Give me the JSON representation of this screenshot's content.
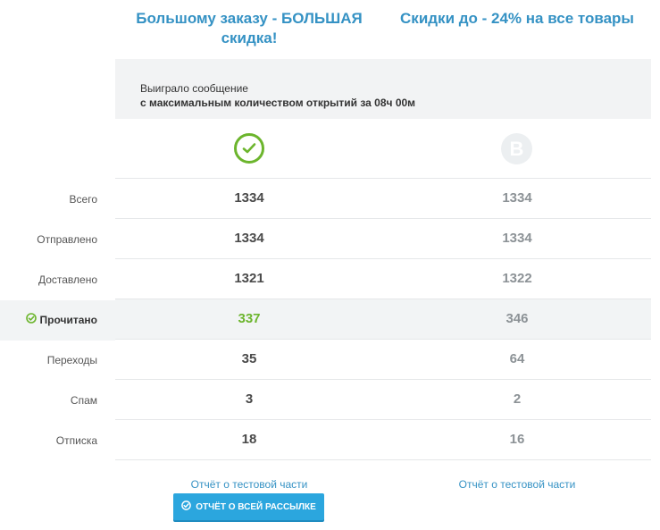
{
  "variants": {
    "a": {
      "title": "Большому заказу - БОЛЬШАЯ скидка!",
      "icon_letter": ""
    },
    "b": {
      "title": "Скидки до - 24% на все товары",
      "icon_letter": "B"
    }
  },
  "winner": {
    "line1": "Выиграло сообщение",
    "line2": "с максимальным количеством открытий за 08ч 00м"
  },
  "rows": [
    {
      "label": "Всего",
      "a": "1334",
      "b": "1334"
    },
    {
      "label": "Отправлено",
      "a": "1334",
      "b": "1334"
    },
    {
      "label": "Доставлено",
      "a": "1321",
      "b": "1322"
    },
    {
      "label": "Прочитано",
      "a": "337",
      "b": "346"
    },
    {
      "label": "Переходы",
      "a": "35",
      "b": "64"
    },
    {
      "label": "Спам",
      "a": "3",
      "b": "2"
    },
    {
      "label": "Отписка",
      "a": "18",
      "b": "16"
    }
  ],
  "links": {
    "a": "Отчёт о тестовой части",
    "b": "Отчёт о тестовой части"
  },
  "button": {
    "label": "Отчёт о всей рассылке"
  },
  "colors": {
    "accent": "#3592c4",
    "winner_green": "#6cb52d",
    "button": "#2ba6de"
  },
  "icons": {
    "winner": "check-circle-icon",
    "variant_b": "letter-b-circle-icon",
    "read_row": "check-circle-icon",
    "button": "check-circle-icon"
  }
}
